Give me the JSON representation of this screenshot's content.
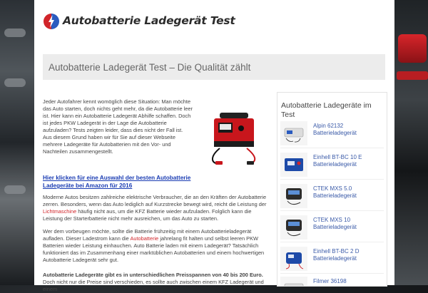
{
  "site": {
    "name": "Autobatterie Ladegerät Test",
    "brand_colors": {
      "accent": "#d1252a",
      "logo_blue": "#2a5bbf",
      "link": "#1a3cb3"
    }
  },
  "page": {
    "title": "Autobatterie Ladegerät Test – Die Qualität zählt"
  },
  "content": {
    "intro": "Jeder Autofahrer kennt womöglich diese Situation: Man möchte das Auto starten, doch nichts geht mehr, da die Autobatterie leer ist. Hier kann ein Autobatterie Ladegerät Abhilfe schaffen. Doch ist jedes PKW Ladegerät in der Lage die Autobatterie aufzuladen? Tests zeigten leider, dass dies nicht der Fall ist. Aus diesem Grund haben wir für Sie auf dieser Webseite mehrere Ladegeräte für Autobatterien mit den Vor- und Nachteilen zusammengestellt.",
    "cta_link": "Hier klicken für eine Auswahl der besten Autobatterie Ladegeräte bei Amazon für 2016",
    "p2_a": "Moderne Autos besitzen zahlreiche elektrische Verbraucher, die an den Kräften der Autobatterie zerren. Besonders, wenn das Auto lediglich auf Kurzstrecke bewegt wird, reicht die Leistung der ",
    "p2_link": "Lichtmaschine",
    "p2_b": " häufig nicht aus, um die KFZ Batterie wieder aufzuladen. Folglich kann die Leistung der Starterbatterie nicht mehr ausreichen, um das Auto zu starten.",
    "p3_a": "Wer dem vorbeugen möchte, sollte die Batterie frühzeitig mit einem Autobatterieladegerät aufladen. Dieser Ladestrom kann die ",
    "p3_link": "Autobatterie",
    "p3_b": " jahrelang fit halten und selbst leeren PKW Batterien wieder Leistung einhauchen. Auto Batterie laden mit einem Ladegerät? Tatsächlich funktioniert das im Zusammenhang einer marktüblichen Autobatterien und einem hochwertigen Autobatterie Ladegerät sehr gut.",
    "p4_bold": "Autobatterie Ladegeräte gibt es in unterschiedlichen Preisspannen von 40 bis 200 Euro.",
    "p4_rest": " Doch nicht nur die Preise sind verschieden, es sollte auch zwischen einem KFZ Ladegerät und einem"
  },
  "sidebar": {
    "title": "Autobatterie Ladegeräte im Test",
    "items": [
      {
        "label": "Alpin 62132 Batterieladegerät",
        "icon": "charger-white-icon"
      },
      {
        "label": "Einhell BT-BC 10 E Batterieladegerät",
        "icon": "charger-blue-icon"
      },
      {
        "label": "CTEK MXS 5.0 Batterieladegerät",
        "icon": "charger-ctek-icon"
      },
      {
        "label": "CTEK MXS 10 Batterieladegerät",
        "icon": "charger-ctek-icon"
      },
      {
        "label": "Einhell BT-BC 2 D Batterieladegerät",
        "icon": "charger-blue-icon"
      },
      {
        "label": "Filmer 36198 Batterieladegerät",
        "icon": "charger-white-icon"
      }
    ]
  }
}
